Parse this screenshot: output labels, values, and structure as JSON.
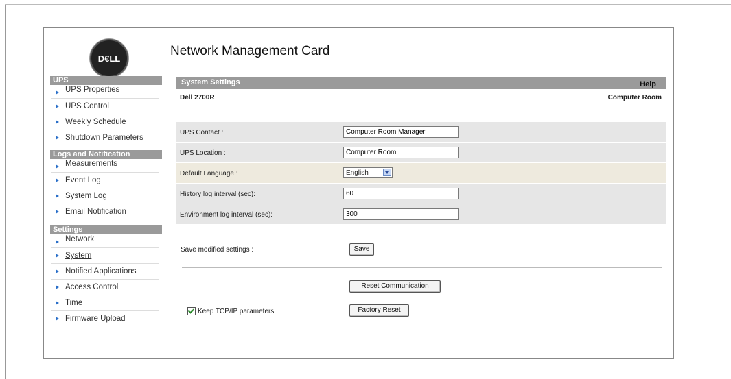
{
  "header": {
    "logo_text": "D€LL",
    "title": "Network Management Card"
  },
  "sidebar": {
    "sections": [
      {
        "title": "UPS",
        "items": [
          "UPS Properties",
          "UPS Control",
          "Weekly Schedule",
          "Shutdown Parameters"
        ]
      },
      {
        "title": "Logs and Notification",
        "items": [
          "Measurements",
          "Event Log",
          "System Log",
          "Email Notification"
        ]
      },
      {
        "title": "Settings",
        "items": [
          "Network",
          "System",
          "Notified Applications",
          "Access Control",
          "Time",
          "Firmware Upload"
        ]
      }
    ],
    "active_item": "System"
  },
  "content": {
    "section_title": "System Settings",
    "help_label": "Help",
    "device_name": "Dell 2700R",
    "location_name": "Computer Room",
    "fields": {
      "ups_contact": {
        "label": "UPS Contact :",
        "value": "Computer Room Manager"
      },
      "ups_location": {
        "label": "UPS Location :",
        "value": "Computer Room"
      },
      "default_language": {
        "label": "Default Language :",
        "value": "English"
      },
      "history_interval": {
        "label": "History log interval (sec):",
        "value": "60"
      },
      "environment_interval": {
        "label": "Environment log interval (sec):",
        "value": "300"
      }
    },
    "save_label": "Save modified settings :",
    "save_button": "Save",
    "reset_comm_button": "Reset Communication",
    "keep_tcpip_label": "Keep TCP/IP parameters",
    "keep_tcpip_checked": true,
    "factory_reset_button": "Factory Reset"
  }
}
